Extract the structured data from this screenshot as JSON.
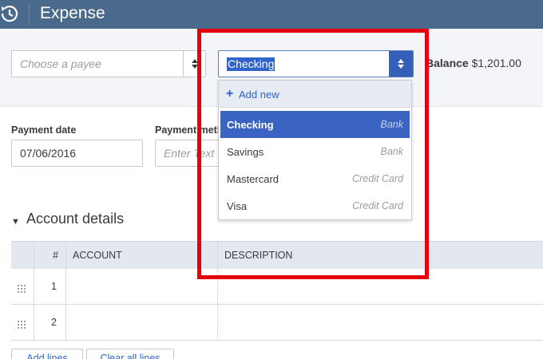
{
  "window": {
    "title": "Expense"
  },
  "payee": {
    "placeholder": "Choose a payee"
  },
  "account_select": {
    "value": "Checking"
  },
  "balance": {
    "label": "Balance",
    "amount": "$1,201.00"
  },
  "payment_date": {
    "label": "Payment date",
    "value": "07/06/2016"
  },
  "payment_method": {
    "label": "Payment meth",
    "placeholder": "Enter Text"
  },
  "dropdown": {
    "add_new_label": "Add new",
    "items": [
      {
        "name": "Checking",
        "type": "Bank",
        "selected": true
      },
      {
        "name": "Savings",
        "type": "Bank",
        "selected": false
      },
      {
        "name": "Mastercard",
        "type": "Credit Card",
        "selected": false
      },
      {
        "name": "Visa",
        "type": "Credit Card",
        "selected": false
      }
    ]
  },
  "account_details": {
    "title": "Account details",
    "columns": [
      "#",
      "ACCOUNT",
      "DESCRIPTION"
    ],
    "rows": [
      {
        "num": "1"
      },
      {
        "num": "2"
      }
    ]
  },
  "buttons": {
    "add_lines": "Add lines",
    "clear_all_lines": "Clear all lines"
  },
  "colors": {
    "titlebar": "#4a6a8c",
    "accent_blue": "#3a63c2",
    "highlight_red": "#e3000f"
  },
  "icons": {
    "title": "history-clock-icon",
    "payee_toggle": "up-down-arrows-icon",
    "account_toggle": "up-down-arrows-icon",
    "add_new": "plus-icon",
    "row_handle": "drag-handle-icon",
    "section_caret": "caret-down-icon"
  }
}
